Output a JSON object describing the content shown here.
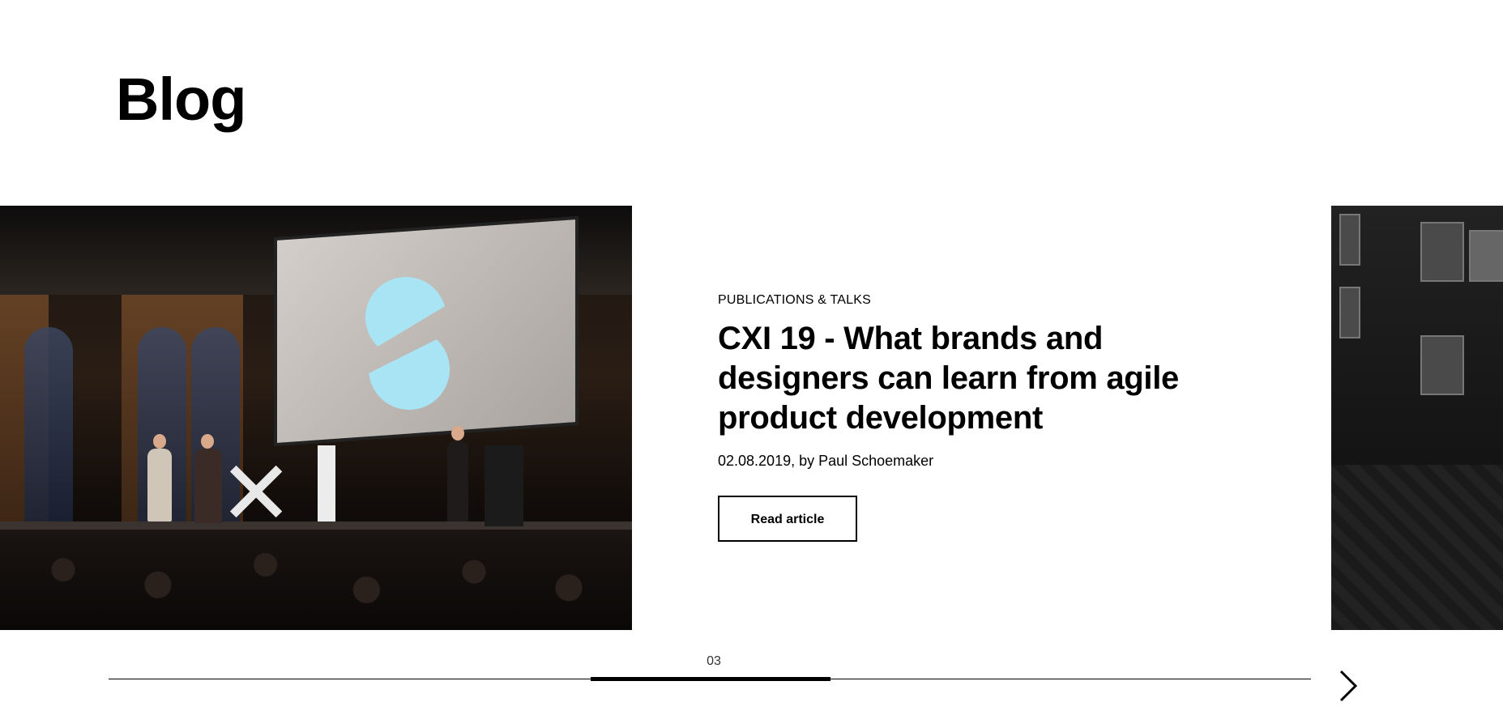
{
  "page": {
    "title": "Blog"
  },
  "slide": {
    "category": "PUBLICATIONS & TALKS",
    "title": "CXI 19 - What brands and designers can learn from agile product development",
    "meta": "02.08.2019, by Paul Schoemaker",
    "cta_label": "Read article",
    "image_left_icon": "stage-photo",
    "image_right_icon": "street-photo"
  },
  "slider": {
    "current": "03",
    "progress": 0.2,
    "next_icon": "chevron-right-icon"
  }
}
